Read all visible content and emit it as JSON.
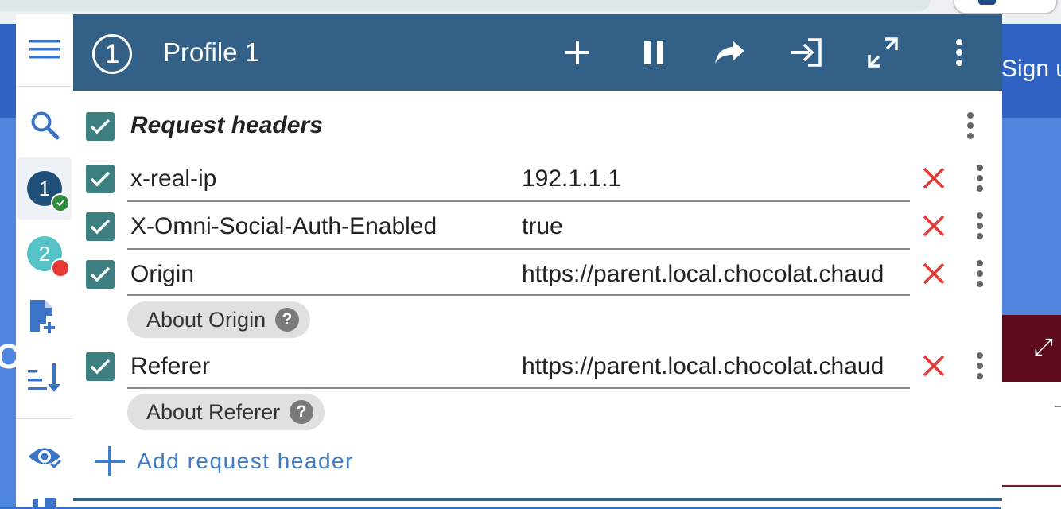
{
  "background": {
    "sign_text": "Sign u",
    "left_letter": "C"
  },
  "sidebar": {
    "profiles": [
      {
        "number": "1",
        "color": "#1f4f78",
        "status": "ok"
      },
      {
        "number": "2",
        "color": "#55c2c8",
        "status": "error"
      }
    ],
    "icons": [
      "menu-icon",
      "search-icon",
      "add-file-icon",
      "sort-icon",
      "eye-icon"
    ]
  },
  "header": {
    "profile_number": "1",
    "profile_title": "Profile 1",
    "buttons": [
      "add-icon",
      "pause-icon",
      "share-icon",
      "login-icon",
      "expand-icon",
      "more-vert-icon"
    ]
  },
  "section": {
    "title": "Request headers",
    "add_label": "Add request header"
  },
  "headers": [
    {
      "name": "x-real-ip",
      "value": "192.1.1.1",
      "enabled": true,
      "about": ""
    },
    {
      "name": "X-Omni-Social-Auth-Enabled",
      "value": "true",
      "enabled": true,
      "about": ""
    },
    {
      "name": "Origin",
      "value": "https://parent.local.chocolat.chaud",
      "enabled": true,
      "about": "About Origin"
    },
    {
      "name": "Referer",
      "value": "https://parent.local.chocolat.chaud",
      "enabled": true,
      "about": "About Referer"
    }
  ],
  "colors": {
    "header_bg": "#336087",
    "checkbox": "#3d7f80",
    "delete": "#e53935",
    "link": "#3f7cc4"
  }
}
